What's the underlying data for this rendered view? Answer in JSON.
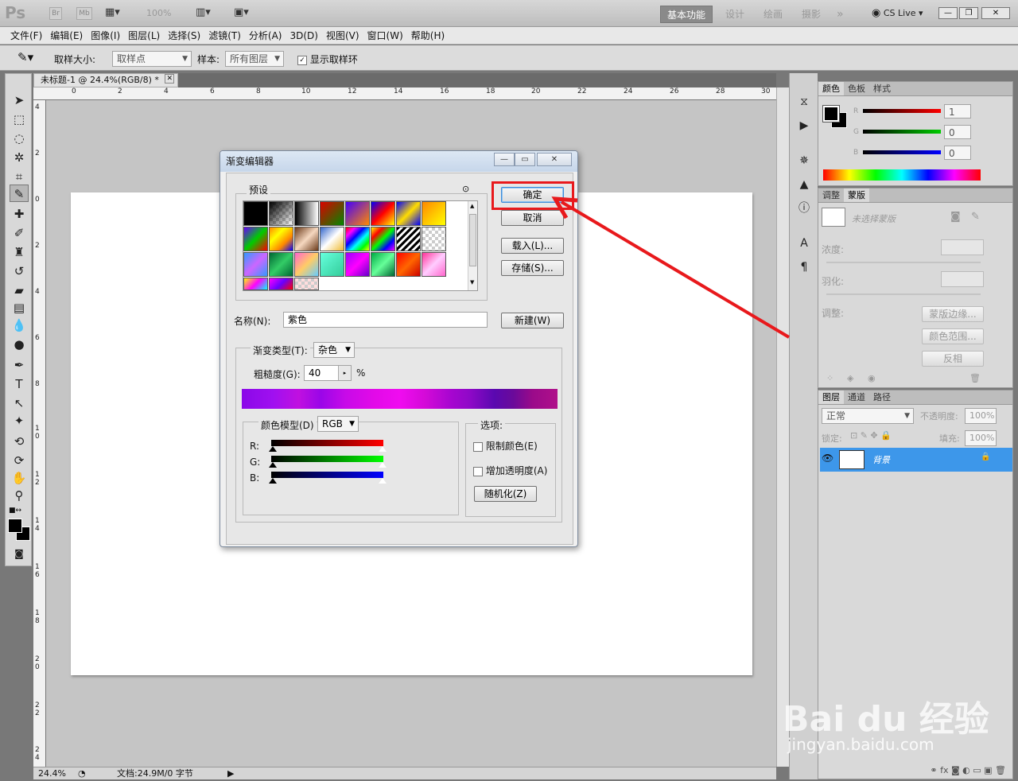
{
  "app": {
    "logo": "Ps",
    "mini1": "Br",
    "mini2": "Mb",
    "zoom_level": "100%"
  },
  "workspaces": [
    "基本功能",
    "设计",
    "绘画",
    "摄影"
  ],
  "more": "»",
  "cs_live": "CS Live",
  "menu": [
    "文件(F)",
    "编辑(E)",
    "图像(I)",
    "图层(L)",
    "选择(S)",
    "滤镜(T)",
    "分析(A)",
    "3D(D)",
    "视图(V)",
    "窗口(W)",
    "帮助(H)"
  ],
  "options": {
    "sample_size_label": "取样大小:",
    "sample_size_value": "取样点",
    "sample_label": "样本:",
    "sample_value": "所有图层",
    "show_ring_label": "显示取样环"
  },
  "doc": {
    "tab_title": "未标题-1 @ 24.4%(RGB/8) *",
    "zoom": "24.4%",
    "doc_info": "文档:24.9M/0 字节"
  },
  "ruler_h": [
    "0",
    "2",
    "4",
    "6",
    "8",
    "10",
    "12",
    "14",
    "16",
    "18",
    "20",
    "22",
    "24",
    "26",
    "28",
    "30"
  ],
  "ruler_v": [
    "4",
    "2",
    "0",
    "2",
    "4",
    "6",
    "8",
    "1 0",
    "1 2",
    "1 4",
    "1 6",
    "1 8",
    "2 0",
    "2 2",
    "2 4"
  ],
  "dialog": {
    "title": "渐变编辑器",
    "presets_label": "预设",
    "ok": "确定",
    "cancel": "取消",
    "load": "载入(L)...",
    "save": "存储(S)...",
    "name_label": "名称(N):",
    "name_value": "紫色",
    "new": "新建(W)",
    "type_label": "渐变类型(T):",
    "type_value": "杂色",
    "rough_label": "粗糙度(G):",
    "rough_value": "40",
    "pct": "%",
    "model_label": "颜色模型(D)",
    "model_value": "RGB",
    "r": "R:",
    "g": "G:",
    "b": "B:",
    "options_label": "选项:",
    "restrict": "限制颜色(E)",
    "add_trans": "增加透明度(A)",
    "randomize": "随机化(Z)"
  },
  "color_panel": {
    "tabs": [
      "颜色",
      "色板",
      "样式"
    ],
    "r_label": "R",
    "g_label": "G",
    "b_label": "B",
    "r": "1",
    "g": "0",
    "b": "0"
  },
  "adj_panel": {
    "tabs": [
      "调整",
      "蒙版"
    ],
    "no_mask": "未选择蒙版",
    "density": "浓度:",
    "feather": "羽化:",
    "refine": "调整:",
    "mask_edge": "蒙版边缘...",
    "color_range": "颜色范围...",
    "invert": "反相"
  },
  "layers_panel": {
    "tabs": [
      "图层",
      "通道",
      "路径"
    ],
    "blend": "正常",
    "opacity_label": "不透明度:",
    "opacity": "100%",
    "lock_label": "锁定:",
    "fill_label": "填充:",
    "fill": "100%",
    "layer_name": "背景"
  },
  "watermark": {
    "brand": "Bai du 经验",
    "url": "jingyan.baidu.com"
  },
  "colors": {
    "accent": "#e8191c",
    "layer_sel": "#3d97ea"
  }
}
